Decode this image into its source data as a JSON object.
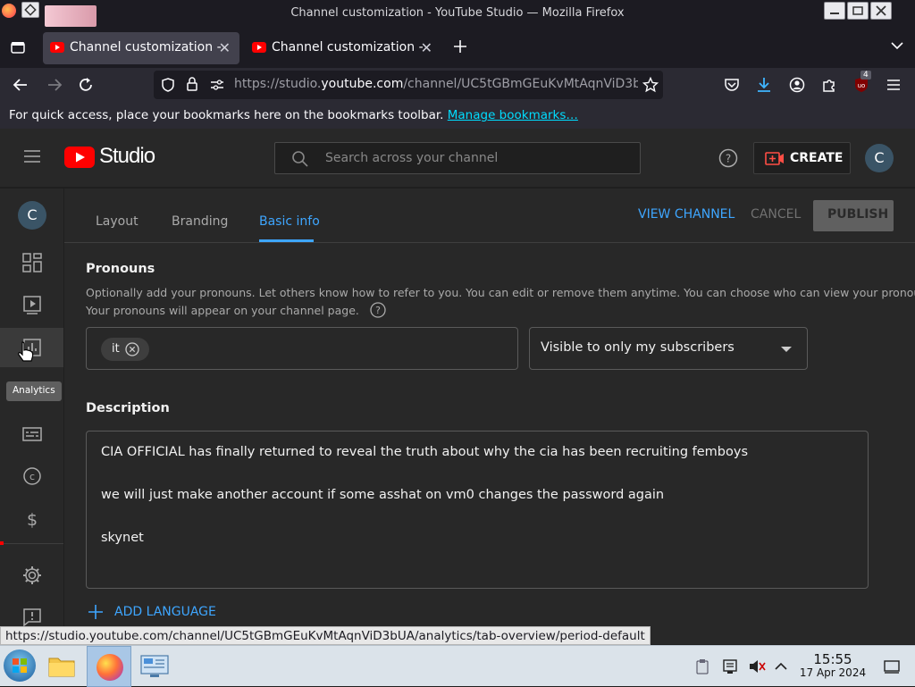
{
  "window": {
    "title": "Channel customization - YouTube Studio — Mozilla Firefox"
  },
  "browser": {
    "tabs": [
      {
        "label": "Channel customization -",
        "active": true
      },
      {
        "label": "Channel customization -",
        "active": false
      }
    ],
    "url_prefix": "https://studio.",
    "url_domain": "youtube.com",
    "url_rest": "/channel/UC5tGBmGEuKvMtAqnViD3b",
    "extension_badge": "4",
    "bookmarks_text": "For quick access, place your bookmarks here on the bookmarks toolbar.",
    "bookmarks_link": "Manage bookmarks…"
  },
  "studio": {
    "logo_text": "Studio",
    "search_placeholder": "Search across your channel",
    "create_label": "CREATE",
    "avatar_letter": "C"
  },
  "leftnav": {
    "channel_avatar": "C",
    "tooltip": "Analytics"
  },
  "customization": {
    "tabs": [
      "Layout",
      "Branding",
      "Basic info"
    ],
    "active_tab": "Basic info",
    "view_channel": "VIEW CHANNEL",
    "cancel": "CANCEL",
    "publish": "PUBLISH",
    "pronouns": {
      "heading": "Pronouns",
      "help_line1": "Optionally add your pronouns. Let others know how to refer to you. You can edit or remove them anytime. You can choose who can view your pronouns.",
      "help_line2": "Your pronouns will appear on your channel page.",
      "chip": "it",
      "visibility": "Visible to only my subscribers"
    },
    "description": {
      "heading": "Description",
      "lines": [
        "CIA OFFICIAL has finally returned to reveal the truth about why the cia has been recruiting femboys",
        "we will just make another account if some asshat on vm0 changes the password again",
        "skynet"
      ]
    },
    "add_language": "ADD LANGUAGE"
  },
  "status_link": "https://studio.youtube.com/channel/UC5tGBmGEuKvMtAqnViD3bUA/analytics/tab-overview/period-default",
  "taskbar": {
    "time": "15:55",
    "date": "17 Apr 2024"
  },
  "colors": {
    "accent": "#3ea6ff",
    "youtube_red": "#ff0000",
    "firefox_link": "#00ddff"
  }
}
